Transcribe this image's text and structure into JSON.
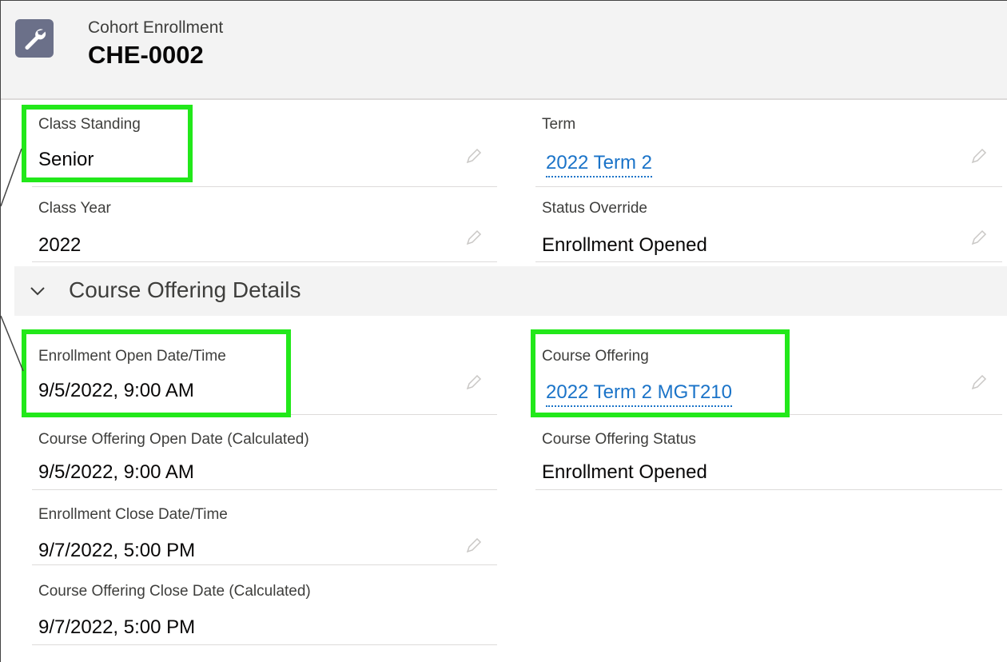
{
  "header": {
    "object_label": "Cohort Enrollment",
    "record_name": "CHE-0002",
    "icon": "wrench-icon"
  },
  "fields": {
    "class_standing": {
      "label": "Class Standing",
      "value": "Senior"
    },
    "term": {
      "label": "Term",
      "value": "2022 Term 2"
    },
    "class_year": {
      "label": "Class Year",
      "value": "2022"
    },
    "status_override": {
      "label": "Status Override",
      "value": "Enrollment Opened"
    },
    "enrollment_open": {
      "label": "Enrollment Open Date/Time",
      "value": "9/5/2022, 9:00 AM"
    },
    "course_offering": {
      "label": "Course Offering",
      "value": "2022 Term 2 MGT210"
    },
    "co_open_calc": {
      "label": "Course Offering Open Date (Calculated)",
      "value": "9/5/2022, 9:00 AM"
    },
    "co_status": {
      "label": "Course Offering Status",
      "value": "Enrollment Opened"
    },
    "enrollment_close": {
      "label": "Enrollment Close Date/Time",
      "value": "9/7/2022, 5:00 PM"
    },
    "co_close_calc": {
      "label": "Course Offering Close Date (Calculated)",
      "value": "9/7/2022, 5:00 PM"
    }
  },
  "section": {
    "title": "Course Offering Details",
    "icon": "chevron-down-icon"
  },
  "colors": {
    "highlight": "#22e81a",
    "link": "#1a73c8",
    "header_bg": "#f3f3f3",
    "icon_bg": "#6b7089"
  }
}
